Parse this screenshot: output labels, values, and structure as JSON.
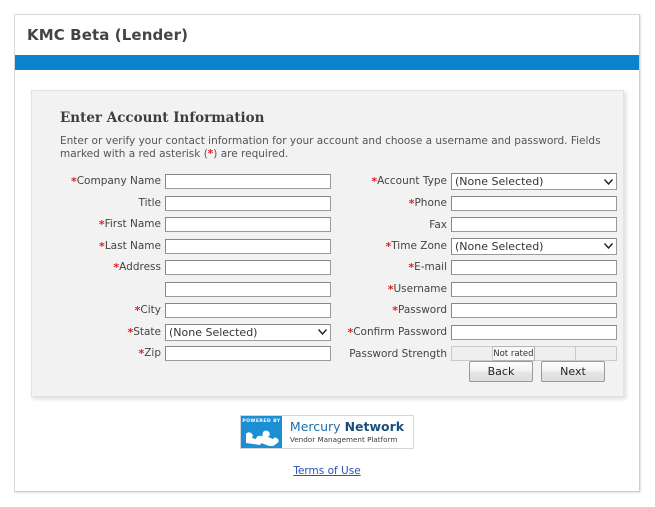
{
  "header": {
    "title": "KMC Beta (Lender)",
    "accent_color": "#0b84ce"
  },
  "section": {
    "title": "Enter Account Information",
    "description_before_star": "Enter or verify your contact information for your account and choose a username and password. Fields marked with a red asterisk (",
    "star": "*",
    "description_after_star": ") are required."
  },
  "form": {
    "left_column": [
      {
        "label": "Company Name",
        "required": true,
        "type": "text",
        "value": ""
      },
      {
        "label": "Title",
        "required": false,
        "type": "text",
        "value": ""
      },
      {
        "label": "First Name",
        "required": true,
        "type": "text",
        "value": ""
      },
      {
        "label": "Last Name",
        "required": true,
        "type": "text",
        "value": ""
      },
      {
        "label": "Address",
        "required": true,
        "type": "text",
        "value": ""
      },
      {
        "label": "",
        "required": false,
        "type": "text",
        "value": ""
      },
      {
        "label": "City",
        "required": true,
        "type": "text",
        "value": ""
      },
      {
        "label": "State",
        "required": true,
        "type": "select",
        "value": "(None Selected)"
      },
      {
        "label": "Zip",
        "required": true,
        "type": "text",
        "value": ""
      }
    ],
    "right_column": [
      {
        "label": "Account Type",
        "required": true,
        "type": "select",
        "value": "(None Selected)"
      },
      {
        "label": "Phone",
        "required": true,
        "type": "text",
        "value": ""
      },
      {
        "label": "Fax",
        "required": false,
        "type": "text",
        "value": ""
      },
      {
        "label": "Time Zone",
        "required": true,
        "type": "select",
        "value": "(None Selected)"
      },
      {
        "label": "E-mail",
        "required": true,
        "type": "text",
        "value": ""
      },
      {
        "label": "Username",
        "required": true,
        "type": "text",
        "value": ""
      },
      {
        "label": "Password",
        "required": true,
        "type": "password",
        "value": ""
      },
      {
        "label": "Confirm Password",
        "required": true,
        "type": "password",
        "value": ""
      },
      {
        "label": "Password Strength",
        "required": false,
        "type": "strength",
        "value": "Not rated"
      }
    ]
  },
  "strength": {
    "label": "Password Strength",
    "rating": "Not rated",
    "cells": [
      "",
      "Not rated",
      "",
      ""
    ],
    "rated_index": 1
  },
  "buttons": {
    "back": "Back",
    "next": "Next"
  },
  "footer": {
    "logo_powered_by": "POWERED BY",
    "logo_name_light": "Mercury ",
    "logo_name_bold": "Network",
    "logo_tagline": "Vendor Management Platform",
    "terms_link": "Terms of Use"
  }
}
